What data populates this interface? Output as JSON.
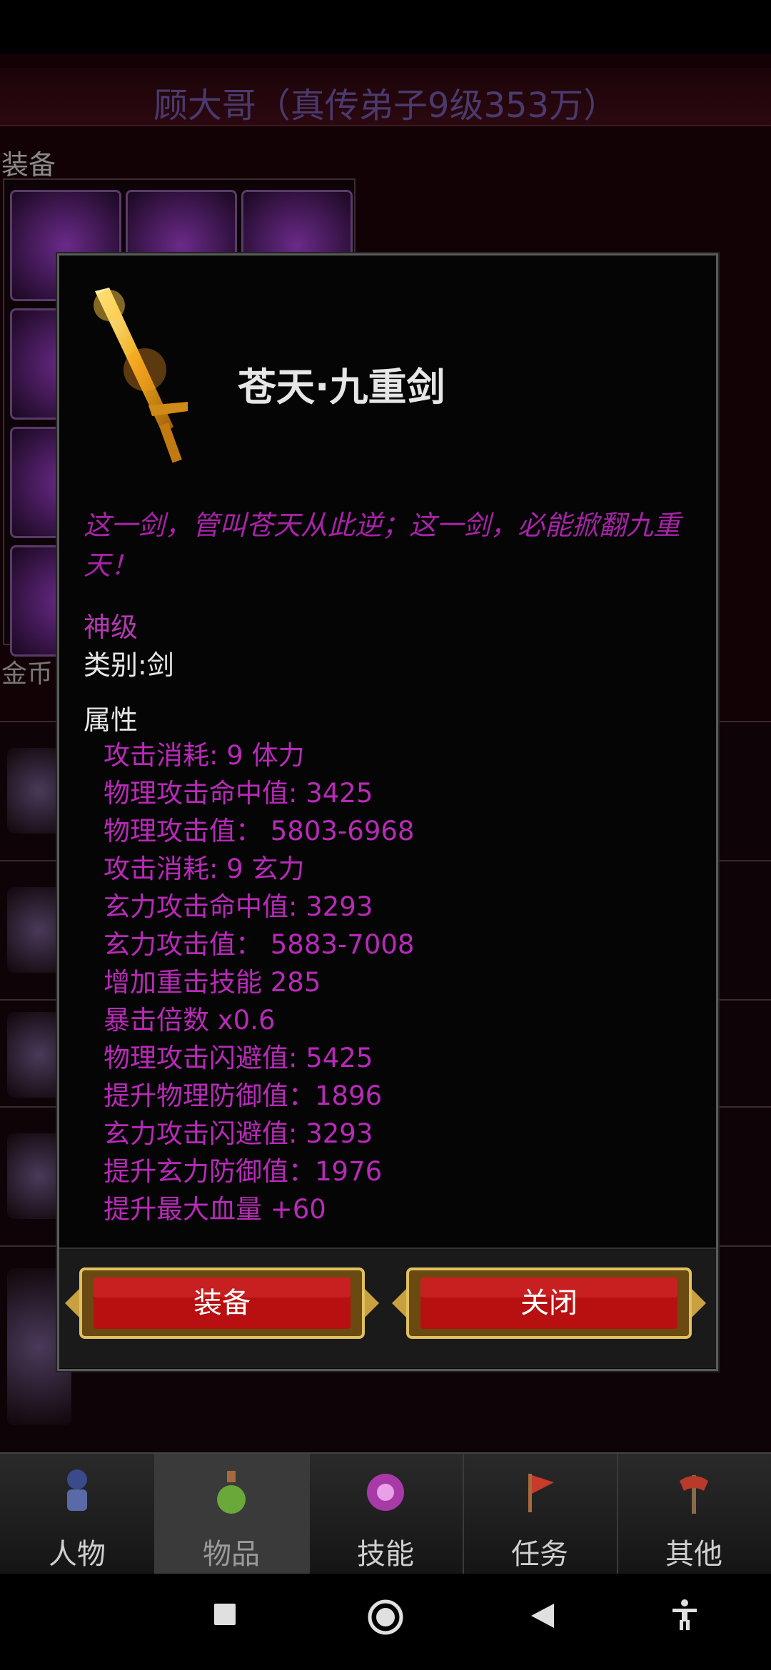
{
  "header": {
    "character_title": "顾大哥（真传弟子9级353万）"
  },
  "equipment": {
    "label": "装备"
  },
  "currency": {
    "label": "金币"
  },
  "item_dialog": {
    "name": "苍天·九重剑",
    "description": "这一剑，管叫苍天从此逆；这一剑，必能掀翻九重天！",
    "grade": "神级",
    "category": "类别:剑",
    "attributes_title": "属性",
    "attributes": [
      "攻击消耗: 9 体力",
      "物理攻击命中值: 3425",
      "物理攻击值： 5803-6968",
      "攻击消耗: 9 玄力",
      "玄力攻击命中值: 3293",
      "玄力攻击值： 5883-7008",
      "增加重击技能 285",
      "暴击倍数 x0.6",
      "物理攻击闪避值: 5425",
      "提升物理防御值：1896",
      "玄力攻击闪避值: 3293",
      "提升玄力防御值：1976",
      "提升最大血量 +60"
    ],
    "equip_button": "装备",
    "close_button": "关闭"
  },
  "tabs": [
    {
      "label": "人物"
    },
    {
      "label": "物品"
    },
    {
      "label": "技能"
    },
    {
      "label": "任务"
    },
    {
      "label": "其他"
    }
  ],
  "colors": {
    "accent_purple": "#b82ab8",
    "button_red": "#b81010",
    "gold_border": "#c8a040"
  }
}
